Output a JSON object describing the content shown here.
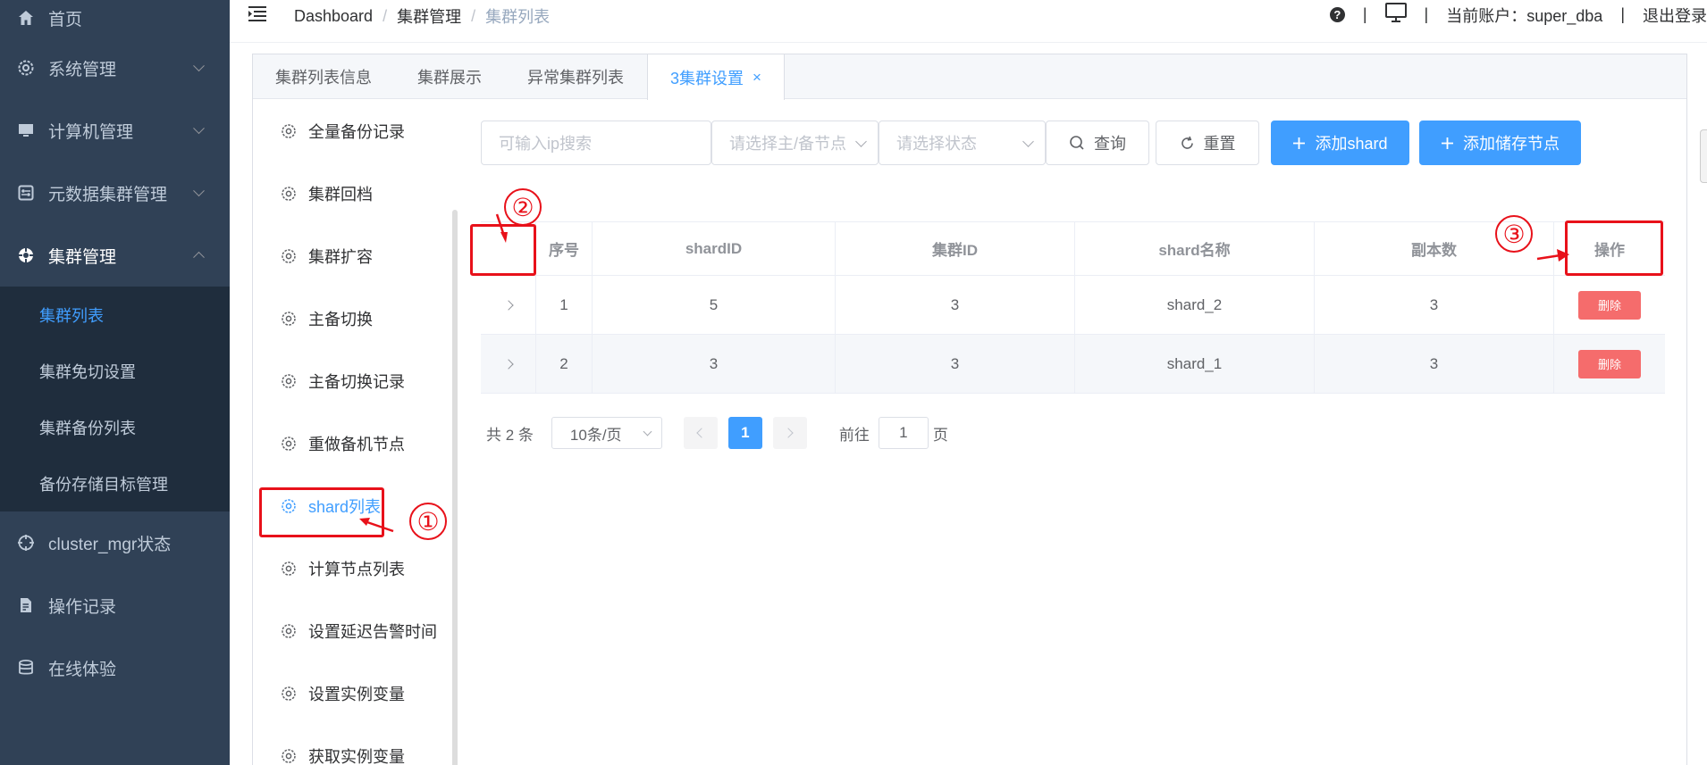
{
  "sidebar": {
    "items": [
      {
        "label": "首页",
        "icon": "home-icon"
      },
      {
        "label": "系统管理",
        "icon": "gear-icon"
      },
      {
        "label": "计算机管理",
        "icon": "monitor-icon"
      },
      {
        "label": "元数据集群管理",
        "icon": "cluster-meta-icon"
      },
      {
        "label": "集群管理",
        "icon": "cluster-icon"
      },
      {
        "label": "cluster_mgr状态",
        "icon": "target-icon"
      },
      {
        "label": "操作记录",
        "icon": "document-icon"
      },
      {
        "label": "在线体验",
        "icon": "database-icon"
      }
    ],
    "submenu": [
      "集群列表",
      "集群免切设置",
      "集群备份列表",
      "备份存储目标管理"
    ]
  },
  "header": {
    "breadcrumb": [
      "Dashboard",
      "集群管理",
      "集群列表"
    ],
    "account_label": "当前账户：super_dba",
    "logout_label": "退出登录",
    "separator": "|"
  },
  "tabs": [
    {
      "label": "集群列表信息"
    },
    {
      "label": "集群展示"
    },
    {
      "label": "异常集群列表"
    },
    {
      "label": "3集群设置",
      "close": "×"
    }
  ],
  "settings": [
    "全量备份记录",
    "集群回档",
    "集群扩容",
    "主备切换",
    "主备切换记录",
    "重做备机节点",
    "shard列表",
    "计算节点列表",
    "设置延迟告警时间",
    "设置实例变量",
    "获取实例变量"
  ],
  "toolbar": {
    "ip_placeholder": "可输入ip搜索",
    "node_placeholder": "请选择主/备节点",
    "status_placeholder": "请选择状态",
    "search_label": "查询",
    "reset_label": "重置",
    "add_shard_label": "添加shard",
    "add_storage_label": "添加储存节点"
  },
  "table": {
    "headers": [
      "序号",
      "shardID",
      "集群ID",
      "shard名称",
      "副本数",
      "操作"
    ],
    "rows": [
      {
        "index": "1",
        "shard_id": "5",
        "cluster_id": "3",
        "name": "shard_2",
        "replicas": "3",
        "action": "删除"
      },
      {
        "index": "2",
        "shard_id": "3",
        "cluster_id": "3",
        "name": "shard_1",
        "replicas": "3",
        "action": "删除"
      }
    ]
  },
  "pager": {
    "total": "共 2 条",
    "page_size": "10条/页",
    "current_page": "1",
    "goto_prefix": "前往",
    "goto_value": "1",
    "goto_suffix": "页"
  },
  "annotations": [
    "①",
    "②",
    "③"
  ],
  "colors": {
    "sidebar_bg": "#304156",
    "accent": "#409eff",
    "danger": "#f56c6c",
    "annotation": "#e8111a"
  }
}
